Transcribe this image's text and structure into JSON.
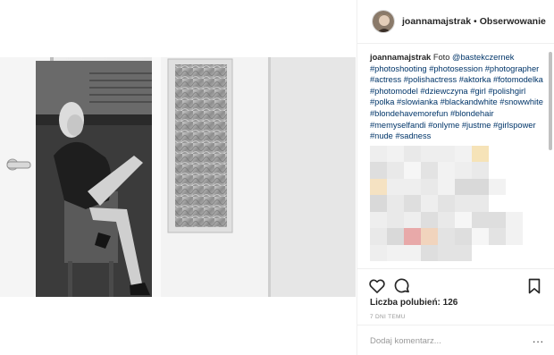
{
  "post": {
    "username": "joannamajstrak",
    "separator": "•",
    "follow_label": "Obserwowanie"
  },
  "caption": {
    "username": "joannamajstrak",
    "text": "Foto",
    "tags": [
      "@bastekczernek",
      "#photoshooting",
      "#photosession",
      "#photographer",
      "#actress",
      "#polishactress",
      "#aktorka",
      "#fotomodelka",
      "#photomodel",
      "#dziewczyna",
      "#girl",
      "#polishgirl",
      "#polka",
      "#slowianka",
      "#blackandwhite",
      "#snowwhite",
      "#blondehavemorefun",
      "#blondehair",
      "#memyselfandi",
      "#onlyme",
      "#justme",
      "#girlspower",
      "#nude",
      "#sadness"
    ]
  },
  "actions": {
    "icons": [
      "heart-icon",
      "comment-icon",
      "bookmark-icon"
    ]
  },
  "likes": {
    "label": "Liczba polubień:",
    "count": "126"
  },
  "timestamp": "7 DNI TEMU",
  "comment": {
    "placeholder": "Dodaj komentarz...",
    "more": "..."
  },
  "colors": {
    "link": "#003569",
    "border": "#efefef",
    "muted": "#999999",
    "text": "#262626"
  }
}
